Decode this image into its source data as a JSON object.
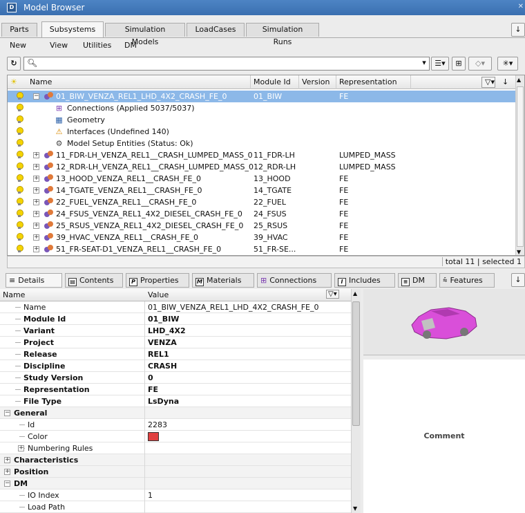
{
  "window": {
    "title": "Model Browser"
  },
  "top_tabs": [
    "Parts",
    "Subsystems",
    "Simulation Models",
    "LoadCases",
    "Simulation Runs"
  ],
  "active_top_tab": "Subsystems",
  "menu": [
    "New",
    "View",
    "Utilities",
    "DM"
  ],
  "search": {
    "value": ""
  },
  "tree": {
    "columns": {
      "name": "Name",
      "module_id": "Module Id",
      "version": "Version",
      "representation": "Representation"
    },
    "rows": [
      {
        "name": "01_BIW_VENZA_REL1_LHD_4X2_CRASH_FE_0",
        "module_id": "01_BIW",
        "representation": "FE",
        "selected": true,
        "kind": "system",
        "expander": "−"
      },
      {
        "name": "Connections (Applied 5037/5037)",
        "kind": "child",
        "icon": "connections-icon"
      },
      {
        "name": "Geometry",
        "kind": "child",
        "icon": "geometry-icon"
      },
      {
        "name": "Interfaces (Undefined 140)",
        "kind": "child",
        "icon": "interfaces-icon"
      },
      {
        "name": "Model Setup Entities (Status: Ok)",
        "kind": "child",
        "icon": "model-setup-icon"
      },
      {
        "name": "11_FDR-LH_VENZA_REL1__CRASH_LUMPED_MASS_0",
        "module_id": "11_FDR-LH",
        "representation": "LUMPED_MASS",
        "kind": "system",
        "expander": "+"
      },
      {
        "name": "12_RDR-LH_VENZA_REL1__CRASH_LUMPED_MASS_0",
        "module_id": "12_RDR-LH",
        "representation": "LUMPED_MASS",
        "kind": "system",
        "expander": "+"
      },
      {
        "name": "13_HOOD_VENZA_REL1__CRASH_FE_0",
        "module_id": "13_HOOD",
        "representation": "FE",
        "kind": "system",
        "expander": "+"
      },
      {
        "name": "14_TGATE_VENZA_REL1__CRASH_FE_0",
        "module_id": "14_TGATE",
        "representation": "FE",
        "kind": "system",
        "expander": "+"
      },
      {
        "name": "22_FUEL_VENZA_REL1__CRASH_FE_0",
        "module_id": "22_FUEL",
        "representation": "FE",
        "kind": "system",
        "expander": "+"
      },
      {
        "name": "24_FSUS_VENZA_REL1_4X2_DIESEL_CRASH_FE_0",
        "module_id": "24_FSUS",
        "representation": "FE",
        "kind": "system",
        "expander": "+"
      },
      {
        "name": "25_RSUS_VENZA_REL1_4X2_DIESEL_CRASH_FE_0",
        "module_id": "25_RSUS",
        "representation": "FE",
        "kind": "system",
        "expander": "+"
      },
      {
        "name": "39_HVAC_VENZA_REL1__CRASH_FE_0",
        "module_id": "39_HVAC",
        "representation": "FE",
        "kind": "system",
        "expander": "+"
      },
      {
        "name": "51_FR-SEAT-D1_VENZA_REL1__CRASH_FE_0",
        "module_id": "51_FR-SE...",
        "representation": "FE",
        "kind": "system",
        "expander": "+"
      }
    ]
  },
  "status": {
    "text": "total 11 | selected 1"
  },
  "bottom_tabs": [
    "Details",
    "Contents",
    "Properties",
    "Materials",
    "Connections",
    "Includes",
    "DM",
    "Features"
  ],
  "details": {
    "header": {
      "name": "Name",
      "value": "Value"
    },
    "rows": [
      {
        "name": "Name",
        "value": "01_BIW_VENZA_REL1_LHD_4X2_CRASH_FE_0",
        "bold": false,
        "level": 1
      },
      {
        "name": "Module Id",
        "value": "01_BIW",
        "bold": true,
        "level": 1
      },
      {
        "name": "Variant",
        "value": "LHD_4X2",
        "bold": true,
        "level": 1
      },
      {
        "name": "Project",
        "value": "VENZA",
        "bold": true,
        "level": 1
      },
      {
        "name": "Release",
        "value": "REL1",
        "bold": true,
        "level": 1
      },
      {
        "name": "Discipline",
        "value": "CRASH",
        "bold": true,
        "level": 1
      },
      {
        "name": "Study Version",
        "value": "0",
        "bold": true,
        "level": 1
      },
      {
        "name": "Representation",
        "value": "FE",
        "bold": true,
        "level": 1
      },
      {
        "name": "File Type",
        "value": "LsDyna",
        "bold": true,
        "level": 1
      },
      {
        "name": "General",
        "value": "",
        "bold": true,
        "level": 0,
        "expander": "−"
      },
      {
        "name": "Id",
        "value": "2283",
        "bold": false,
        "level": 2
      },
      {
        "name": "Color",
        "value": "",
        "bold": false,
        "level": 2,
        "swatch": "#e04040"
      },
      {
        "name": "Numbering Rules",
        "value": "",
        "bold": false,
        "level": 2,
        "expander": "+"
      },
      {
        "name": "Characteristics",
        "value": "",
        "bold": true,
        "level": 0,
        "expander": "+"
      },
      {
        "name": "Position",
        "value": "",
        "bold": true,
        "level": 0,
        "expander": "+"
      },
      {
        "name": "DM",
        "value": "",
        "bold": true,
        "level": 0,
        "expander": "−"
      },
      {
        "name": "IO Index",
        "value": "1",
        "bold": false,
        "level": 2
      },
      {
        "name": "Load Path",
        "value": "",
        "bold": false,
        "level": 2
      }
    ]
  },
  "comment": {
    "label": "Comment"
  },
  "colors": {
    "selection": "#8cb8e8",
    "titlebar": "#3a6fb0",
    "model_preview": "#d94fd9"
  }
}
